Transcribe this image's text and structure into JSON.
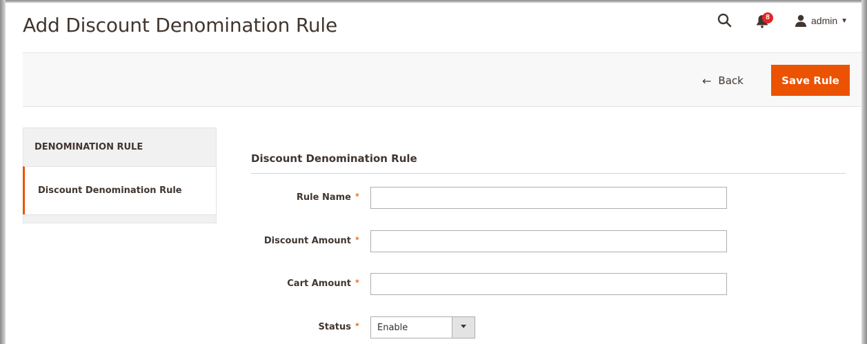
{
  "header": {
    "title": "Add Discount Denomination Rule",
    "notification_count": "8",
    "user_label": "admin"
  },
  "actions": {
    "back_label": "Back",
    "save_label": "Save Rule"
  },
  "sidebar": {
    "heading": "DENOMINATION RULE",
    "items": [
      {
        "label": "Discount Denomination Rule",
        "active": true
      }
    ]
  },
  "form": {
    "section_title": "Discount Denomination Rule",
    "fields": [
      {
        "label": "Rule Name",
        "value": "",
        "required": true
      },
      {
        "label": "Discount Amount",
        "value": "",
        "required": true
      },
      {
        "label": "Cart Amount",
        "value": "",
        "required": true
      },
      {
        "label": "Status",
        "value": "Enable",
        "required": true,
        "type": "select"
      }
    ],
    "required_mark": "*"
  },
  "colors": {
    "accent": "#eb5202",
    "badge": "#e22626",
    "text": "#41362f"
  },
  "icons": [
    "search-icon",
    "bell-icon",
    "user-icon",
    "caret-down-icon",
    "arrow-left-icon"
  ]
}
